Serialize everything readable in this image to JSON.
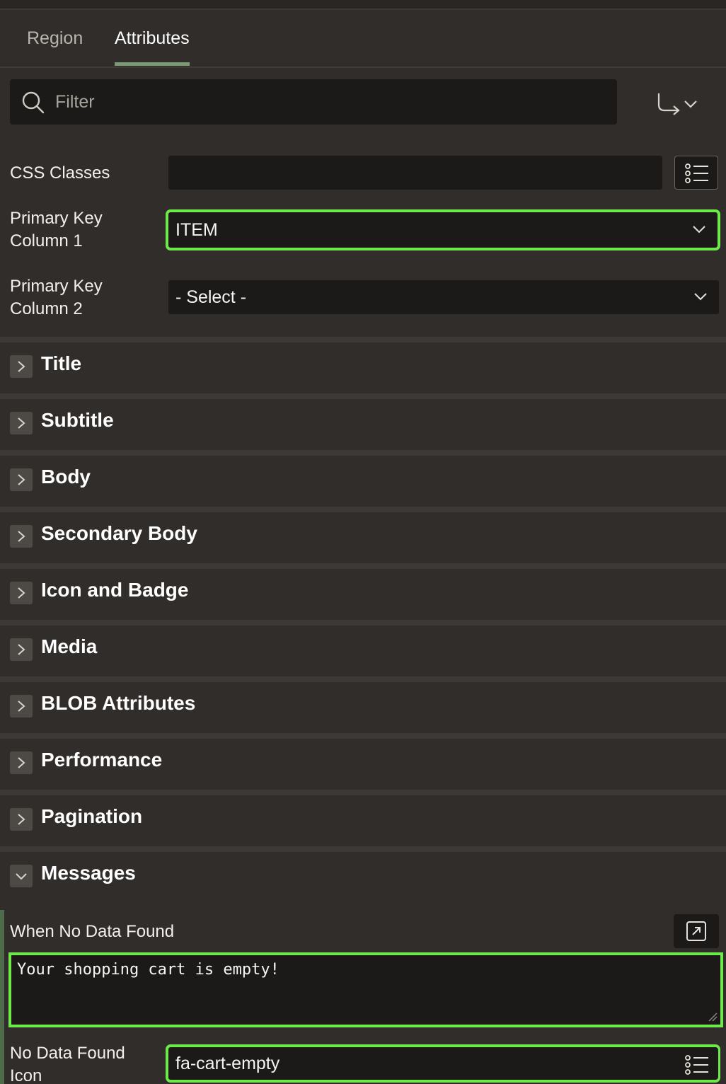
{
  "tabs": [
    {
      "label": "Region",
      "active": false
    },
    {
      "label": "Attributes",
      "active": true
    }
  ],
  "filter": {
    "placeholder": "Filter",
    "value": ""
  },
  "properties": {
    "css_classes": {
      "label": "CSS Classes",
      "value": ""
    },
    "pk1": {
      "label_line1": "Primary Key",
      "label_line2": "Column 1",
      "value": "ITEM"
    },
    "pk2": {
      "label_line1": "Primary Key",
      "label_line2": "Column 2",
      "value": "- Select -"
    }
  },
  "sections": [
    {
      "title": "Title",
      "expanded": false
    },
    {
      "title": "Subtitle",
      "expanded": false
    },
    {
      "title": "Body",
      "expanded": false
    },
    {
      "title": "Secondary Body",
      "expanded": false
    },
    {
      "title": "Icon and Badge",
      "expanded": false
    },
    {
      "title": "Media",
      "expanded": false
    },
    {
      "title": "BLOB Attributes",
      "expanded": false
    },
    {
      "title": "Performance",
      "expanded": false
    },
    {
      "title": "Pagination",
      "expanded": false
    },
    {
      "title": "Messages",
      "expanded": true
    }
  ],
  "messages": {
    "no_data_found": {
      "label": "When No Data Found",
      "value": "Your shopping cart is empty!"
    },
    "no_data_icon": {
      "label_line1": "No Data Found",
      "label_line2": "Icon",
      "value": "fa-cart-empty"
    }
  },
  "colors": {
    "highlight": "#6ee94a",
    "active_tab_underline": "#7a9a74",
    "panel_bg": "#312d2a",
    "field_bg": "#1c1a18"
  },
  "icons": [
    "search-icon",
    "goto-arrow-icon",
    "chevron-down-icon",
    "list-icon",
    "chevron-right-icon",
    "expand-icon",
    "resize-grip-icon"
  ]
}
